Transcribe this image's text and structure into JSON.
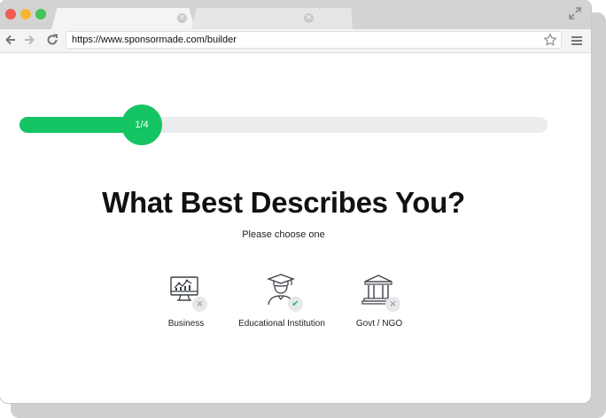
{
  "browser": {
    "url": "https://www.sponsormade.com/builder",
    "icons": {
      "back": "arrow-left-icon",
      "forward": "arrow-right-icon",
      "reload": "reload-icon",
      "bookmark": "star-icon",
      "menu": "hamburger-icon",
      "expand": "expand-icon",
      "tab_close": "close-icon"
    },
    "tab_close_glyph": "×"
  },
  "progress": {
    "step_label": "1/4",
    "fraction": 0.25,
    "color": "#15c463"
  },
  "heading": "What Best Describes You?",
  "subtitle": "Please choose one",
  "options": [
    {
      "label": "Business",
      "icon": "monitor-chart-icon",
      "badge": "×",
      "selected": false
    },
    {
      "label": "Educational Institution",
      "icon": "graduate-icon",
      "badge": "✔",
      "selected": true
    },
    {
      "label": "Govt / NGO",
      "icon": "government-building-icon",
      "badge": "×",
      "selected": false
    }
  ]
}
